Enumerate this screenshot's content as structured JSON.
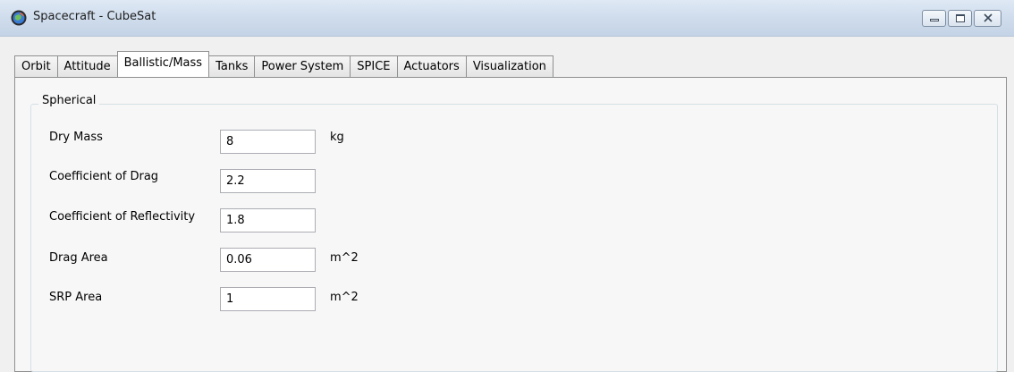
{
  "window": {
    "title": "Spacecraft - CubeSat",
    "controls": [
      "minimize",
      "maximize",
      "close"
    ]
  },
  "tabs": [
    {
      "label": "Orbit",
      "active": false
    },
    {
      "label": "Attitude",
      "active": false
    },
    {
      "label": "Ballistic/Mass",
      "active": true
    },
    {
      "label": "Tanks",
      "active": false
    },
    {
      "label": "Power System",
      "active": false
    },
    {
      "label": "SPICE",
      "active": false
    },
    {
      "label": "Actuators",
      "active": false
    },
    {
      "label": "Visualization",
      "active": false
    }
  ],
  "group": {
    "title": "Spherical",
    "fields": [
      {
        "label": "Dry Mass",
        "value": "8",
        "unit": "kg"
      },
      {
        "label": "Coefficient of Drag",
        "value": "2.2",
        "unit": ""
      },
      {
        "label": "Coefficient of Reflectivity",
        "value": "1.8",
        "unit": ""
      },
      {
        "label": "Drag Area",
        "value": "0.06",
        "unit": "m^2"
      },
      {
        "label": "SRP Area",
        "value": "1",
        "unit": "m^2"
      }
    ]
  }
}
